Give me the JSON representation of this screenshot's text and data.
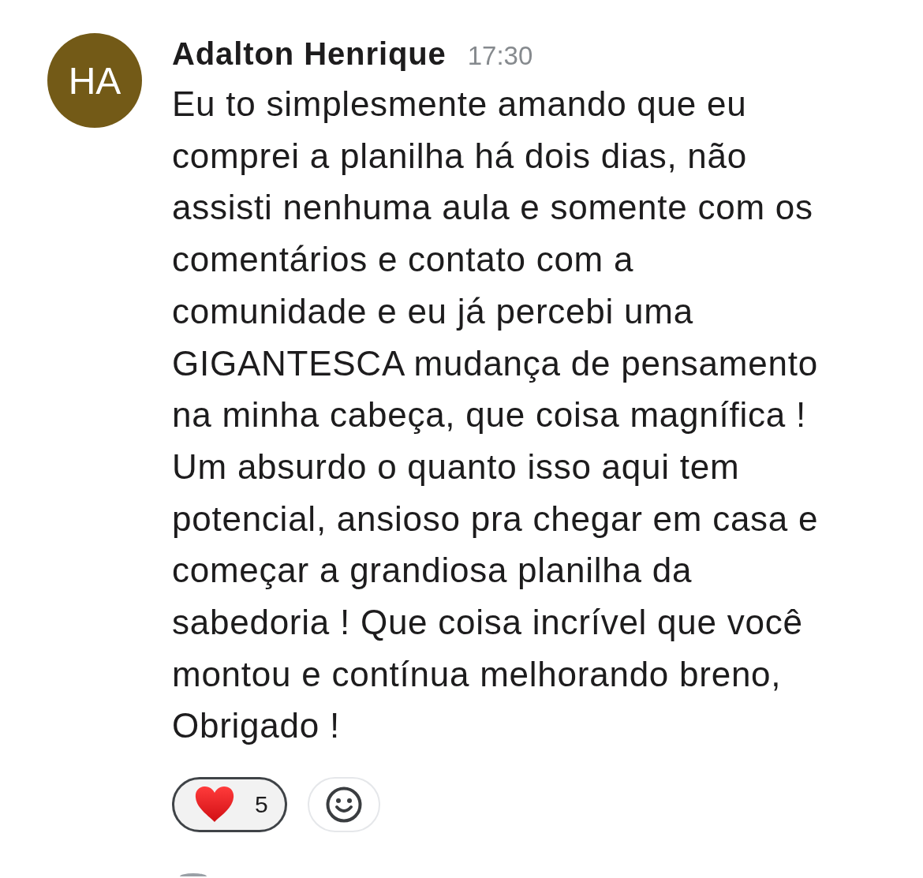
{
  "message": {
    "avatar": {
      "initials": "HA"
    },
    "author": "Adalton Henrique",
    "time": "17:30",
    "body_lines": [
      "Eu to simplesmente amando que eu",
      "comprei a planilha há dois dias, não",
      "assisti nenhuma aula e somente com os",
      "comentários e contato com a",
      "comunidade e eu já percebi uma",
      "GIGANTESCA mudança de pensamento",
      "na minha cabeça, que coisa magnífica !",
      "Um absurdo o quanto isso aqui tem",
      "potencial, ansioso pra chegar em casa e",
      "começar a grandiosa planilha da",
      "sabedoria ! Que coisa incrível que você",
      "montou e contínua melhorando breno,",
      "Obrigado !"
    ],
    "reactions": [
      {
        "kind": "heart",
        "count": "5",
        "selected": true
      }
    ]
  }
}
